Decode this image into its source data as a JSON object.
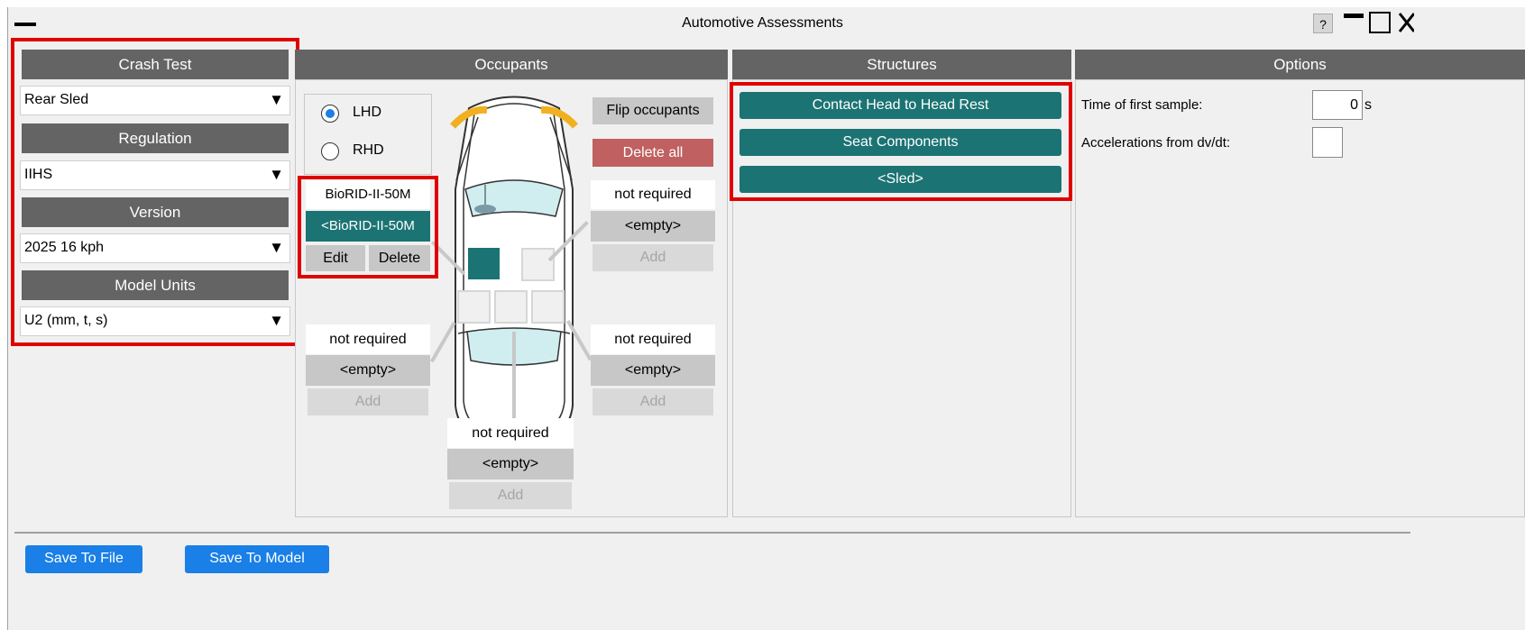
{
  "window": {
    "title": "Automotive Assessments",
    "help_label": "?"
  },
  "crash_test": {
    "header": "Crash Test",
    "value": "Rear Sled",
    "regulation_header": "Regulation",
    "regulation_value": "IIHS",
    "version_header": "Version",
    "version_value": "2025 16 kph",
    "units_header": "Model Units",
    "units_value": "U2 (mm, t, s)",
    "arrow": "▼"
  },
  "occupants": {
    "header": "Occupants",
    "lhd_label": "LHD",
    "rhd_label": "RHD",
    "flip_label": "Flip occupants",
    "delete_all_label": "Delete all",
    "driver": {
      "status": "BioRID-II-50M",
      "value": "<BioRID-II-50M",
      "edit": "Edit",
      "delete": "Delete"
    },
    "front_passenger": {
      "status": "not required",
      "value": "<empty>",
      "add": "Add"
    },
    "rear_left": {
      "status": "not required",
      "value": "<empty>",
      "add": "Add"
    },
    "rear_right": {
      "status": "not required",
      "value": "<empty>",
      "add": "Add"
    },
    "rear_middle": {
      "status": "not required",
      "value": "<empty>",
      "add": "Add"
    }
  },
  "structures": {
    "header": "Structures",
    "items": [
      "Contact Head to Head Rest",
      "Seat Components",
      "<Sled>"
    ]
  },
  "options": {
    "header": "Options",
    "first_sample_label": "Time of first sample:",
    "first_sample_value": "0",
    "first_sample_unit": "s",
    "accel_label": "Accelerations from dv/dt:"
  },
  "footer": {
    "save_file": "Save To File",
    "save_model": "Save To Model"
  },
  "colors": {
    "accent_teal": "#1c7373",
    "header_gray": "#646464",
    "highlight_red": "#e00000",
    "button_blue": "#1a7fe6",
    "delete_red": "#c06060"
  }
}
